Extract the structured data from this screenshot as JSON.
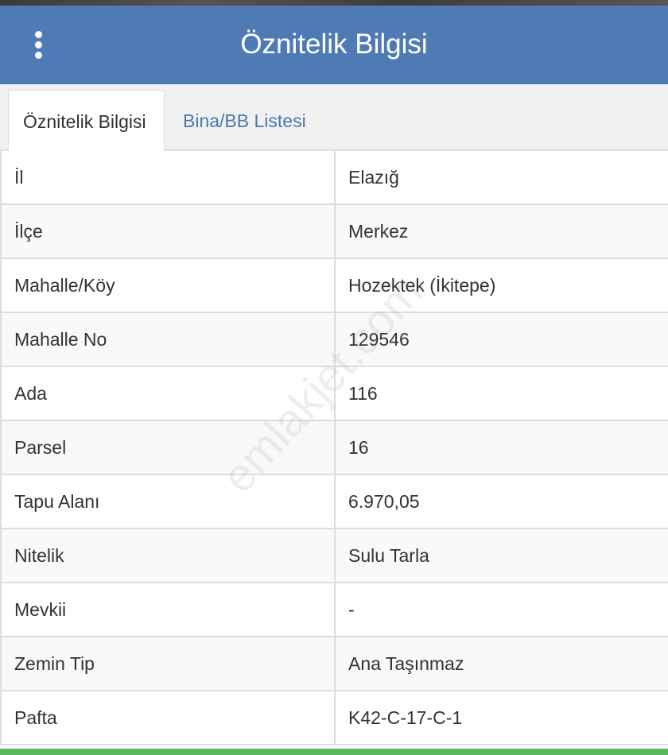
{
  "header": {
    "title": "Öznitelik Bilgisi",
    "menu_icon": "vertical-ellipsis-icon"
  },
  "tabs": [
    {
      "label": "Öznitelik Bilgisi",
      "active": true
    },
    {
      "label": "Bina/BB Listesi",
      "active": false
    }
  ],
  "rows": [
    {
      "key": "İl",
      "value": "Elazığ"
    },
    {
      "key": "İlçe",
      "value": "Merkez"
    },
    {
      "key": "Mahalle/Köy",
      "value": "Hozektek (İkitepe)"
    },
    {
      "key": "Mahalle No",
      "value": "129546"
    },
    {
      "key": "Ada",
      "value": "116"
    },
    {
      "key": "Parsel",
      "value": "16"
    },
    {
      "key": "Tapu Alanı",
      "value": "6.970,05"
    },
    {
      "key": "Nitelik",
      "value": "Sulu Tarla"
    },
    {
      "key": "Mevkii",
      "value": "-"
    },
    {
      "key": "Zemin Tip",
      "value": "Ana Taşınmaz"
    },
    {
      "key": "Pafta",
      "value": "K42-C-17-C-1"
    }
  ],
  "watermark": "emlakjet.com",
  "colors": {
    "header": "#4f7bb5",
    "tab_link": "#4a78b0",
    "bottom_bar": "#5cb85c"
  }
}
